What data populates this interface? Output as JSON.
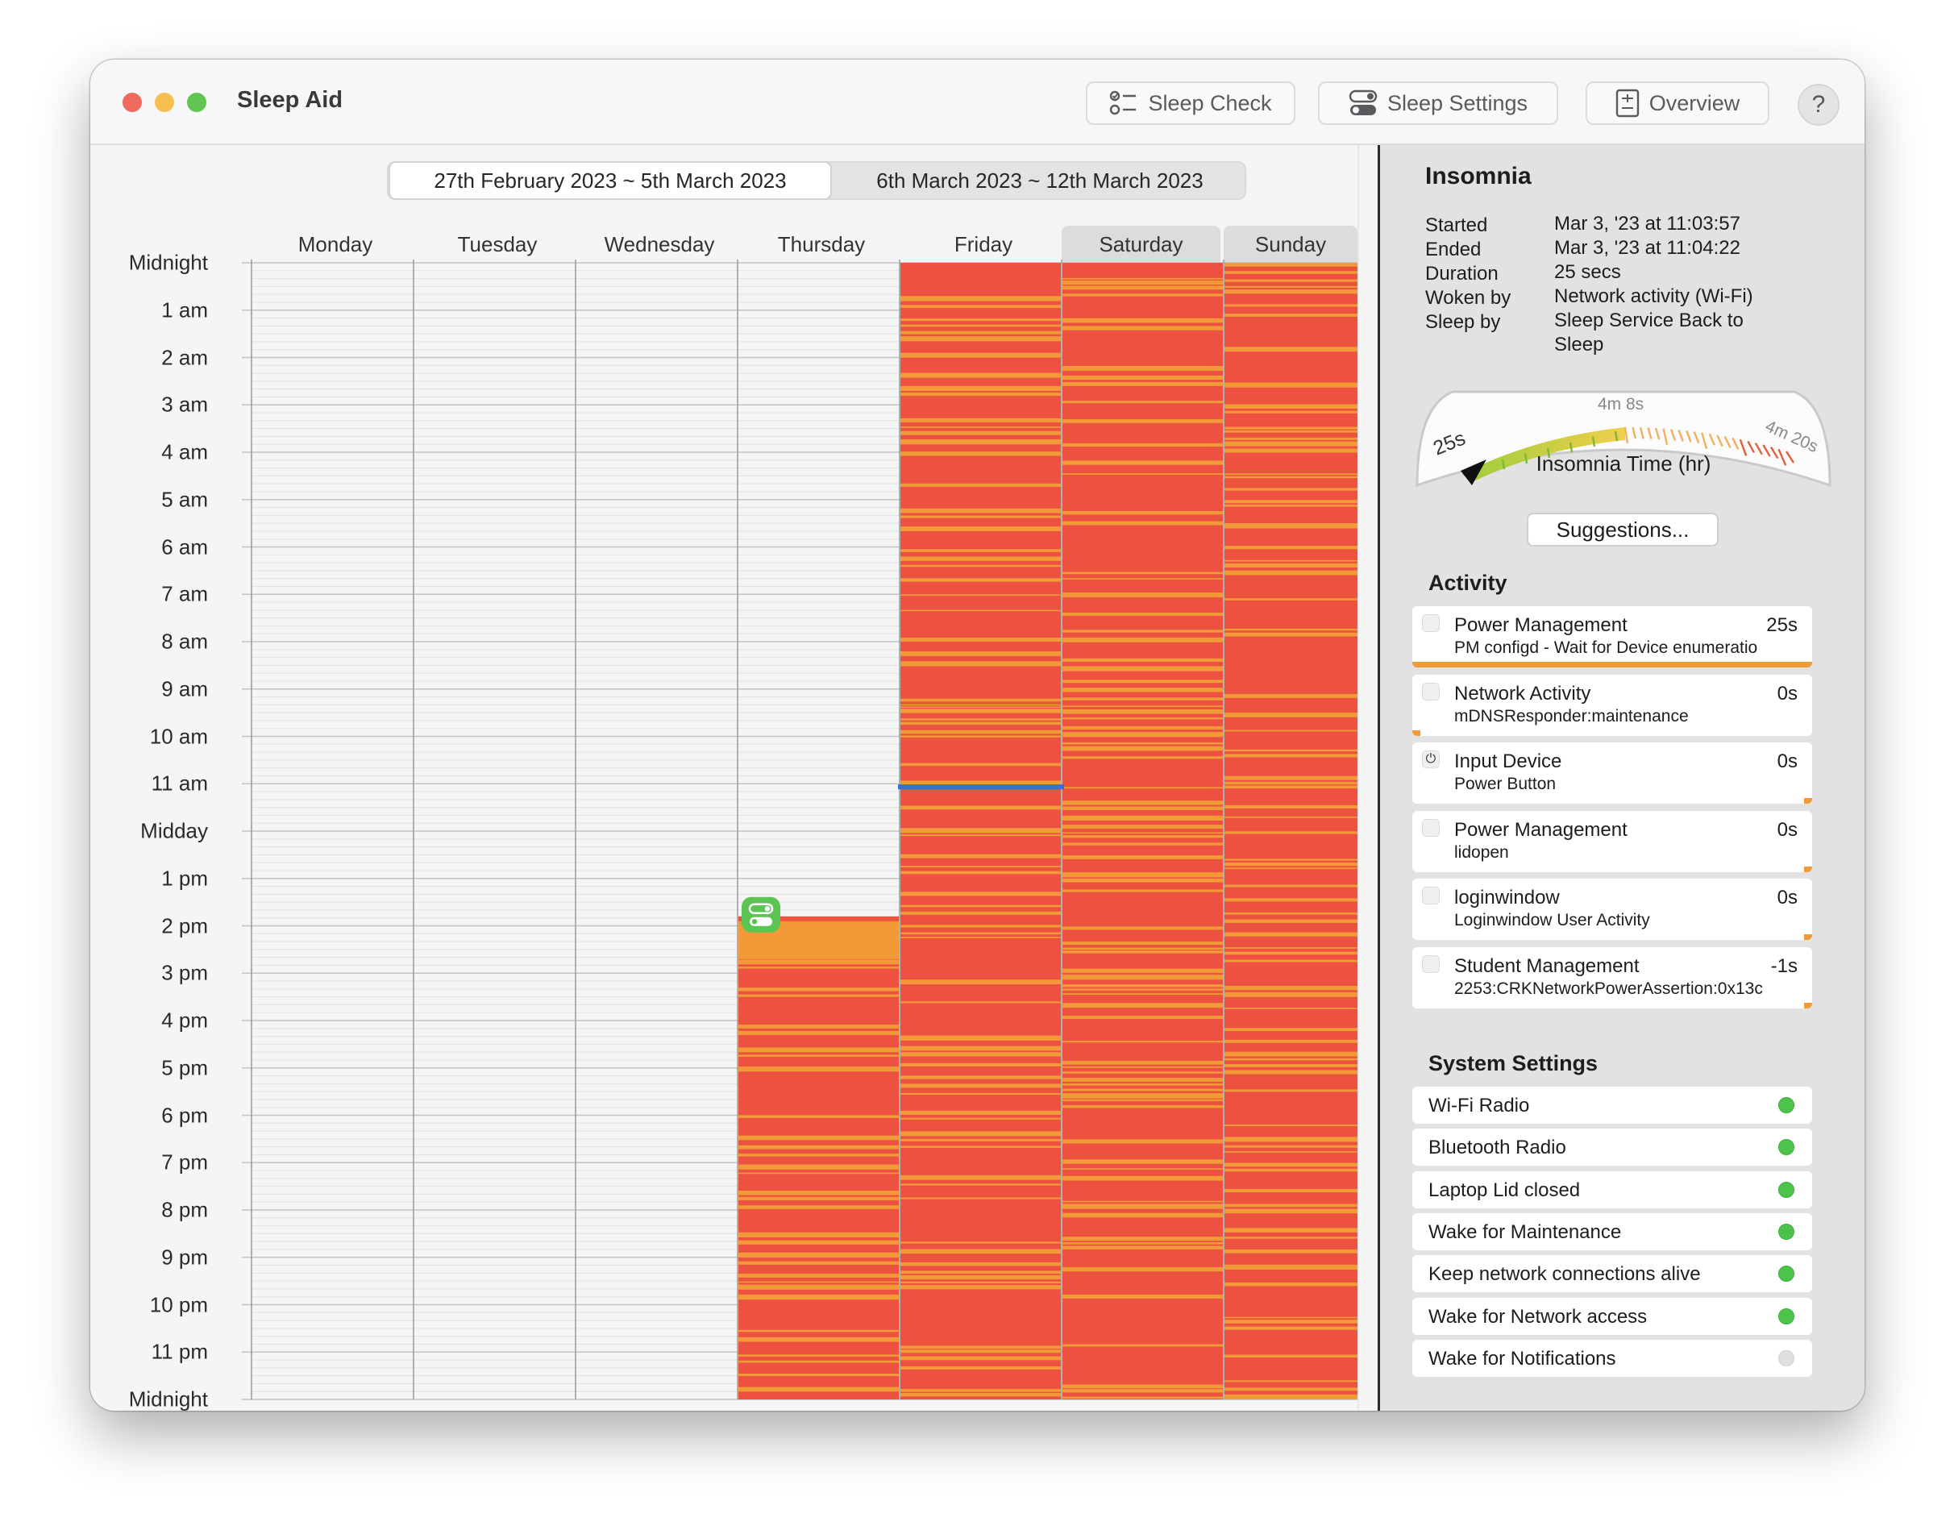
{
  "window": {
    "title": "Sleep Aid"
  },
  "toolbar": {
    "sleep_check": "Sleep Check",
    "sleep_settings": "Sleep Settings",
    "overview": "Overview",
    "help": "?"
  },
  "week_selector": {
    "active": "27th February 2023 ~ 5th March 2023",
    "other": "6th March 2023 ~ 12th March 2023"
  },
  "days": [
    "Monday",
    "Tuesday",
    "Wednesday",
    "Thursday",
    "Friday",
    "Saturday",
    "Sunday"
  ],
  "hours": [
    "Midnight",
    "1 am",
    "2 am",
    "3 am",
    "4 am",
    "5 am",
    "6 am",
    "7 am",
    "8 am",
    "9 am",
    "10 am",
    "11 am",
    "Midday",
    "1 pm",
    "2 pm",
    "3 pm",
    "4 pm",
    "5 pm",
    "6 pm",
    "7 pm",
    "8 pm",
    "9 pm",
    "10 pm",
    "11 pm",
    "Midnight"
  ],
  "colors": {
    "awake_red": "#ec523f",
    "sleep_orange": "#f29a38",
    "marker_blue": "#3a6fd8",
    "status_on": "#4cc44c",
    "status_off": "#e0e0e0"
  },
  "selected_event": {
    "title": "Insomnia",
    "fields": [
      {
        "key": "Started",
        "value": "Mar 3, '23 at 11:03:57"
      },
      {
        "key": "Ended",
        "value": "Mar 3, '23 at 11:04:22"
      },
      {
        "key": "Duration",
        "value": "25 secs"
      },
      {
        "key": "Woken by",
        "value": "Network activity (Wi-Fi)"
      },
      {
        "key": "Sleep by",
        "value": "Sleep Service Back to Sleep"
      }
    ]
  },
  "gauge": {
    "label": "Insomnia Time (hr)",
    "min_label": "25s",
    "mid_label": "4m 8s",
    "max_label": "4m 20s"
  },
  "suggestions_button": "Suggestions...",
  "activity": {
    "heading": "Activity",
    "items": [
      {
        "name": "Power Management",
        "detail": "PM configd - Wait for Device enumeratio",
        "duration": "25s",
        "icon": "power-management-icon",
        "bar_fraction": 1.0
      },
      {
        "name": "Network Activity",
        "detail": "mDNSResponder:maintenance",
        "duration": "0s",
        "icon": "network-activity-icon",
        "bar_fraction": 0.02
      },
      {
        "name": "Input Device",
        "detail": "Power Button",
        "duration": "0s",
        "icon": "power-button-icon",
        "bar_fraction": 0.02
      },
      {
        "name": "Power Management",
        "detail": "lidopen",
        "duration": "0s",
        "icon": "power-management-icon",
        "bar_fraction": 0.02
      },
      {
        "name": "loginwindow",
        "detail": "Loginwindow User Activity",
        "duration": "0s",
        "icon": "loginwindow-icon",
        "bar_fraction": 0.02
      },
      {
        "name": "Student Management",
        "detail": "2253:CRKNetworkPowerAssertion:0x13c",
        "duration": "-1s",
        "icon": "student-management-icon",
        "bar_fraction": 0.02
      }
    ]
  },
  "system_settings": {
    "heading": "System Settings",
    "items": [
      {
        "label": "Wi-Fi Radio",
        "enabled": true
      },
      {
        "label": "Bluetooth Radio",
        "enabled": true
      },
      {
        "label": "Laptop Lid closed",
        "enabled": true
      },
      {
        "label": "Wake for Maintenance",
        "enabled": true
      },
      {
        "label": "Keep network connections alive",
        "enabled": true
      },
      {
        "label": "Wake for Network access",
        "enabled": true
      },
      {
        "label": "Wake for Notifications",
        "enabled": false
      }
    ]
  },
  "timeline": {
    "data_start": {
      "day": "Thursday",
      "hour": 13.8
    },
    "selected_marker": {
      "day": "Friday",
      "time": "11:03:57"
    }
  }
}
